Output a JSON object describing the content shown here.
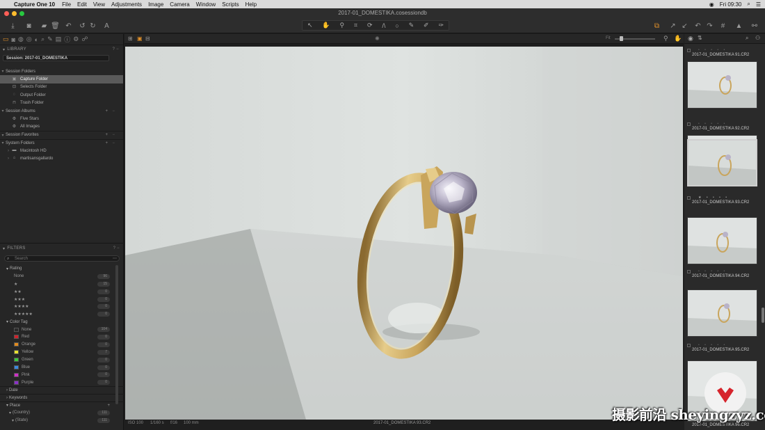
{
  "menubar": {
    "app_name": "Capture One 10",
    "menus": [
      "File",
      "Edit",
      "View",
      "Adjustments",
      "Image",
      "Camera",
      "Window",
      "Scripts",
      "Help"
    ],
    "clock": "Fri 09:30"
  },
  "window": {
    "title": "2017-01_DOMESTIKA.cosessiondb"
  },
  "library": {
    "header": "LIBRARY",
    "session_label": "Session: 2017-01_DOMESTIKA",
    "session_folders_header": "Session Folders",
    "session_folders": [
      "Capture Folder",
      "Selects Folder",
      "Output Folder",
      "Trash Folder"
    ],
    "session_albums_header": "Session Albums",
    "session_albums": [
      "Five Stars",
      "All Images"
    ],
    "session_favorites_header": "Session Favorites",
    "system_folders_header": "System Folders",
    "system_folders": [
      "Macintosh HD",
      "martisansgallardo"
    ]
  },
  "filters": {
    "header": "FILTERS",
    "search_placeholder": "Search",
    "rating_header": "Rating",
    "ratings": [
      {
        "label": "None",
        "count": "96"
      },
      {
        "label": "★",
        "count": "15"
      },
      {
        "label": "★★",
        "count": "0"
      },
      {
        "label": "★★★",
        "count": "0"
      },
      {
        "label": "★★★★",
        "count": "0"
      },
      {
        "label": "★★★★★",
        "count": "0"
      }
    ],
    "color_tag_header": "Color Tag",
    "color_tags": [
      {
        "label": "None",
        "count": "104",
        "color": "#2a2a2a"
      },
      {
        "label": "Red",
        "count": "0",
        "color": "#d0202a"
      },
      {
        "label": "Orange",
        "count": "0",
        "color": "#e08a1e"
      },
      {
        "label": "Yellow",
        "count": "7",
        "color": "#e8e030"
      },
      {
        "label": "Green",
        "count": "0",
        "color": "#3cc83c"
      },
      {
        "label": "Blue",
        "count": "0",
        "color": "#3a8ae0"
      },
      {
        "label": "Pink",
        "count": "0",
        "color": "#d030c8"
      },
      {
        "label": "Purple",
        "count": "0",
        "color": "#8a30c8"
      }
    ],
    "date_header": "Date",
    "keywords_header": "Keywords",
    "place_header": "Place",
    "place_rows": [
      {
        "label": "(Country)",
        "count": "111"
      },
      {
        "label": "(State)",
        "count": "111"
      }
    ]
  },
  "viewer": {
    "info": [
      "ISO 100",
      "1/160 s",
      "f/16",
      "100 mm"
    ],
    "filename": "2017-01_DOMESTIKA 93.CR2"
  },
  "browser": {
    "thumbs": [
      {
        "name": "2017-01_DOMESTIKA 91.CR2",
        "stars": "• • • • •"
      },
      {
        "name": "2017-01_DOMESTIKA 92.CR2",
        "stars": "• • • • •"
      },
      {
        "name": "2017-01_DOMESTIKA 93.CR2",
        "stars": "★ • • • •"
      },
      {
        "name": "2017-01_DOMESTIKA 94.CR2",
        "stars": "• • • • •"
      },
      {
        "name": "2017-01_DOMESTIKA 95.CR2",
        "stars": "• • • • •"
      },
      {
        "name": "2017-01_DOMESTIKA 96.CR2",
        "stars": "• • • • •"
      }
    ]
  },
  "watermark": {
    "text": "摄影前沿 sheyingzyz.com"
  },
  "colors": {
    "accent": "#e0902a",
    "panel": "#262626",
    "selection": "#5a5a5a"
  }
}
